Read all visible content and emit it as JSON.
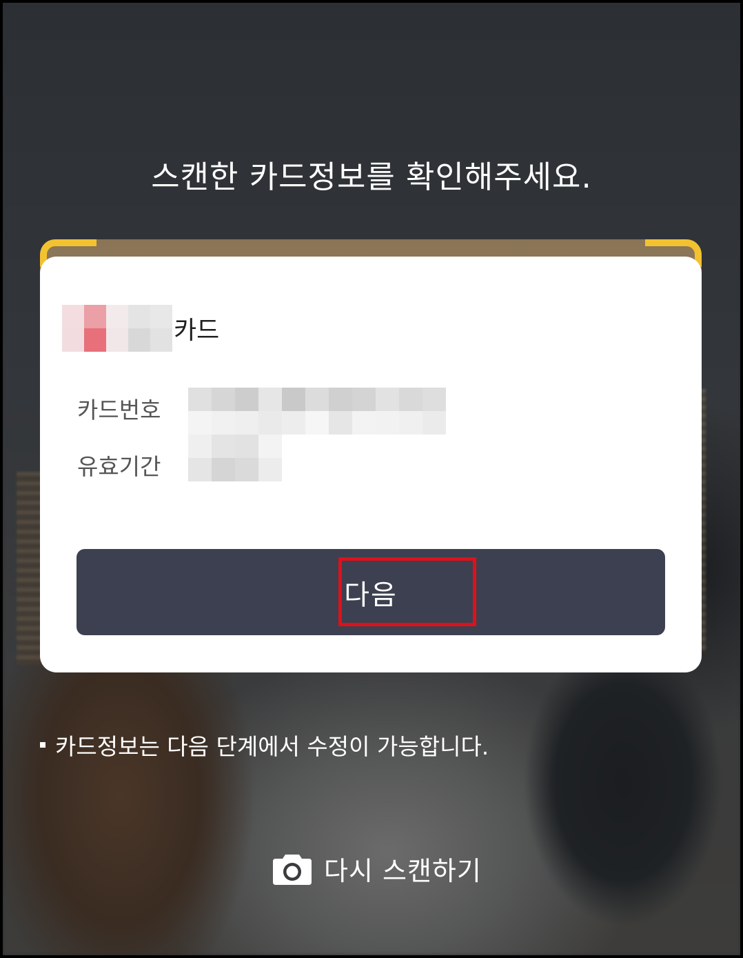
{
  "header": {
    "title": "스캔한 카드정보를 확인해주세요."
  },
  "card": {
    "name_suffix": "카드",
    "number_label": "카드번호",
    "expiry_label": "유효기간",
    "name_mosaic": [
      "#f3dde0",
      "#eaa0a6",
      "#f3eaeb",
      "#e4e4e4",
      "#e8e8e8",
      "#f2dcdf",
      "#e8707b",
      "#f1e6e8",
      "#d8d8d8",
      "#e2e2e2"
    ],
    "number_mosaic": [
      "#e0e0e0",
      "#d6d6d6",
      "#cdcdcd",
      "#e6e6e6",
      "#c9c9c9",
      "#dcdcdc",
      "#d0d0d0",
      "#d4d4d4",
      "#e2e2e2",
      "#d9d9d9",
      "#dedede",
      "#f4f4f4",
      "#f1f1f1",
      "#efefef",
      "#eaeaea",
      "#ededed",
      "#f6f6f6",
      "#e6e6e6",
      "#f3f3f3",
      "#f2f2f2",
      "#f0f0f0",
      "#ebebeb"
    ],
    "expiry_mosaic": [
      "#efefef",
      "#e4e4e4",
      "#e2e2e2",
      "#f3f3f3",
      "#e5e5e5",
      "#d5d5d5",
      "#dadada",
      "#ececec"
    ]
  },
  "actions": {
    "next_label": "다음",
    "rescan_label": "다시 스캔하기"
  },
  "notice": {
    "text": "카드정보는 다음 단계에서 수정이 가능합니다."
  },
  "icons": {
    "camera": "camera-icon"
  },
  "colors": {
    "button_bg": "#3c4050",
    "frame_corner": "#f3c230",
    "highlight": "#e0101a"
  }
}
